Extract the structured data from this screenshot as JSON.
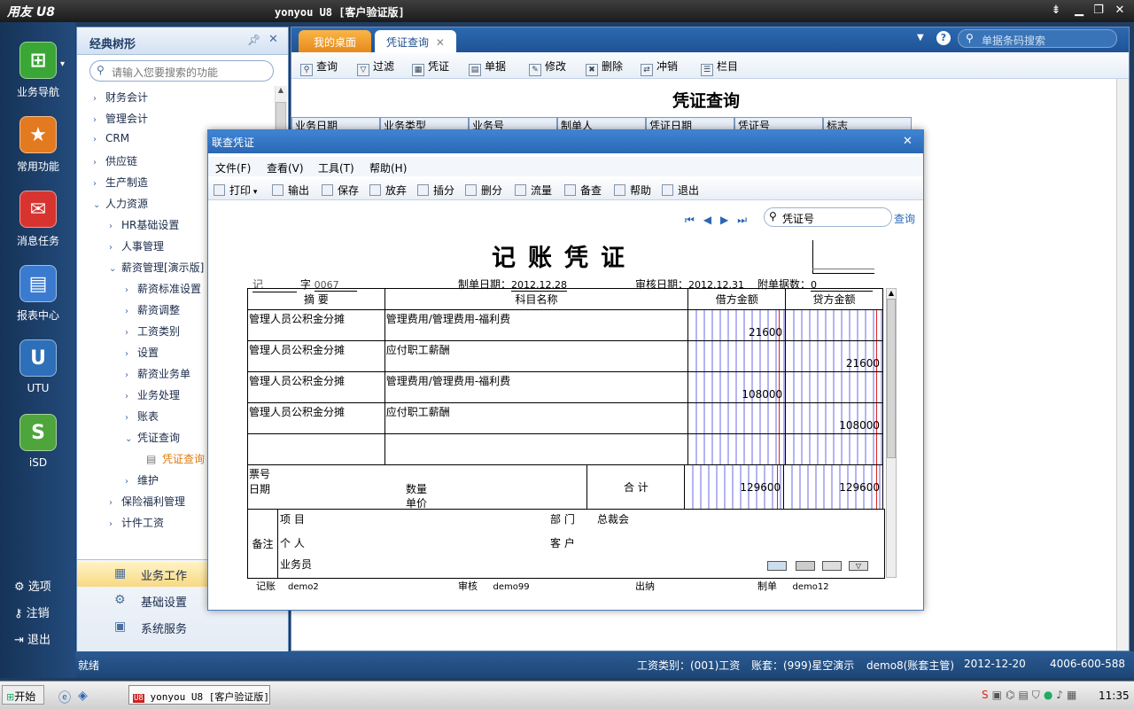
{
  "app": {
    "logo": "用友 U8",
    "title": "yonyou U8 [客户验证版]"
  },
  "rail": {
    "items": [
      {
        "label": "业务导航",
        "color": "#3aa636"
      },
      {
        "label": "常用功能",
        "color": "#e47a1f"
      },
      {
        "label": "消息任务",
        "color": "#d8342f"
      },
      {
        "label": "报表中心",
        "color": "#3a7bd0"
      },
      {
        "label": "UTU",
        "color": "#2d6fb9"
      },
      {
        "label": "iSD",
        "color": "#4ea53b"
      }
    ],
    "bottom": [
      {
        "label": "选项"
      },
      {
        "label": "注销"
      },
      {
        "label": "退出"
      }
    ]
  },
  "tree": {
    "title": "经典树形",
    "search_placeholder": "请输入您要搜索的功能",
    "nodes": [
      {
        "label": "财务会计",
        "arrow": "›"
      },
      {
        "label": "管理会计",
        "arrow": "›"
      },
      {
        "label": "CRM",
        "arrow": "›"
      },
      {
        "label": "供应链",
        "arrow": "›"
      },
      {
        "label": "生产制造",
        "arrow": "›"
      },
      {
        "label": "人力资源",
        "arrow": "⌄"
      },
      {
        "label": "HR基础设置",
        "arrow": "›"
      },
      {
        "label": "人事管理",
        "arrow": "›"
      },
      {
        "label": "薪资管理[演示版]",
        "arrow": "⌄"
      },
      {
        "label": "薪资标准设置",
        "arrow": "›"
      },
      {
        "label": "薪资调整",
        "arrow": "›"
      },
      {
        "label": "工资类别",
        "arrow": "›"
      },
      {
        "label": "设置",
        "arrow": "›"
      },
      {
        "label": "薪资业务单",
        "arrow": "›"
      },
      {
        "label": "业务处理",
        "arrow": "›"
      },
      {
        "label": "账表",
        "arrow": "›"
      },
      {
        "label": "凭证查询",
        "arrow": "⌄"
      },
      {
        "label": "凭证查询",
        "arrow": ""
      },
      {
        "label": "维护",
        "arrow": "›"
      },
      {
        "label": "保险福利管理",
        "arrow": "›"
      },
      {
        "label": "计件工资",
        "arrow": "›"
      }
    ],
    "bottom": [
      {
        "label": "业务工作"
      },
      {
        "label": "基础设置"
      },
      {
        "label": "系统服务"
      }
    ]
  },
  "main": {
    "tabs": [
      {
        "label": "我的桌面"
      },
      {
        "label": "凭证查询"
      }
    ],
    "search_placeholder": "单据条码搜索",
    "toolbar": [
      {
        "label": "查询"
      },
      {
        "label": "过滤"
      },
      {
        "label": "凭证"
      },
      {
        "label": "单据"
      },
      {
        "label": "修改"
      },
      {
        "label": "删除"
      },
      {
        "label": "冲销"
      },
      {
        "label": "栏目"
      }
    ],
    "page_title": "凭证查询",
    "columns": [
      "业务日期",
      "业务类型",
      "业务号",
      "制单人",
      "凭证日期",
      "凭证号",
      "标志"
    ]
  },
  "dialog": {
    "title": "联查凭证",
    "menu": [
      "文件(F)",
      "查看(V)",
      "工具(T)",
      "帮助(H)"
    ],
    "toolbar": [
      {
        "label": "打印"
      },
      {
        "label": "输出"
      },
      {
        "label": "保存"
      },
      {
        "label": "放弃"
      },
      {
        "label": "插分"
      },
      {
        "label": "删分"
      },
      {
        "label": "流量"
      },
      {
        "label": "备查"
      },
      {
        "label": "帮助"
      },
      {
        "label": "退出"
      }
    ],
    "search_placeholder": "凭证号",
    "search_button": "查询",
    "voucher": {
      "title": "记账凭证",
      "type": "记",
      "zi_label": "字",
      "number": "0067",
      "date_label": "制单日期：",
      "date": "2012.12.28",
      "audit_label": "审核日期：",
      "audit_date": "2012.12.31",
      "attach_label": "附单据数：",
      "attachments": "0",
      "headers": {
        "summary": "摘 要",
        "account": "科目名称",
        "debit": "借方金额",
        "credit": "贷方金额"
      },
      "rows": [
        {
          "summary": "管理人员公积金分摊",
          "account": "管理费用/管理费用-福利费",
          "debit": "21600",
          "credit": ""
        },
        {
          "summary": "管理人员公积金分摊",
          "account": "应付职工薪酬",
          "debit": "",
          "credit": "21600"
        },
        {
          "summary": "管理人员公积金分摊",
          "account": "管理费用/管理费用-福利费",
          "debit": "108000",
          "credit": ""
        },
        {
          "summary": "管理人员公积金分摊",
          "account": "应付职工薪酬",
          "debit": "",
          "credit": "108000"
        }
      ],
      "ticket_label": "票号",
      "date_row_label": "日期",
      "qty_label": "数量",
      "price_label": "单价",
      "total_label": "合 计",
      "total_debit": "129600",
      "total_credit": "129600",
      "remark_label": "备注",
      "project_label": "项 目",
      "dept_label": "部 门",
      "dept_value": "总裁会",
      "person_label": "个 人",
      "customer_label": "客 户",
      "salesman_label": "业务员",
      "bookkeeper_label": "记账",
      "bookkeeper": "demo2",
      "auditor_label": "审核",
      "auditor": "demo99",
      "cashier_label": "出纳",
      "maker_label": "制单",
      "maker": "demo12"
    }
  },
  "status": {
    "left": "就绪",
    "wage_type": "工资类别：(001)工资",
    "account": "账套：(999)星空演示",
    "user": "demo8(账套主管)",
    "date": "2012-12-20",
    "phone": "4006-600-588"
  },
  "taskbar": {
    "start": "开始",
    "task": "yonyou U8 [客户验证版]",
    "time": "11:35"
  }
}
